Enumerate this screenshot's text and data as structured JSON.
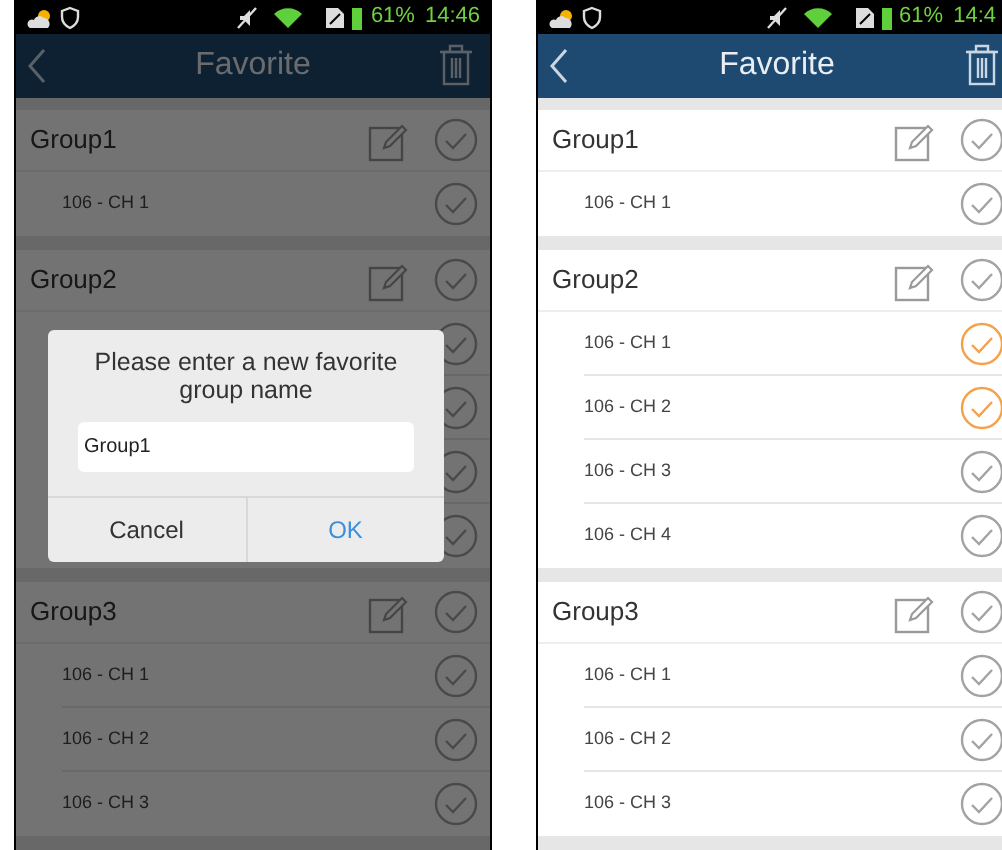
{
  "screens": [
    {
      "status_bar": {
        "battery_percent": "61%",
        "time": "14:46"
      },
      "title": "Favorite",
      "groups": [
        {
          "name": "Group1",
          "selected": false,
          "channels": [
            {
              "label": "106 - CH 1",
              "selected": false
            }
          ]
        },
        {
          "name": "Group2",
          "selected": false,
          "channels": [
            {
              "selected": false
            },
            {
              "selected": false
            },
            {
              "selected": false
            },
            {
              "selected": false
            }
          ]
        },
        {
          "name": "Group3",
          "selected": false,
          "channels": [
            {
              "label": "106 - CH 1",
              "selected": false
            },
            {
              "label": "106 - CH 2",
              "selected": false
            },
            {
              "label": "106 - CH 3",
              "selected": false
            }
          ]
        }
      ],
      "dialog": {
        "message": "Please enter a new favorite group name",
        "value": "Group1",
        "buttons": [
          {
            "label": "Cancel",
            "kind": "cancel"
          },
          {
            "label": "OK",
            "kind": "confirm"
          }
        ]
      }
    },
    {
      "status_bar": {
        "battery_percent": "61%",
        "time": "14:4"
      },
      "title": "Favorite",
      "groups": [
        {
          "name": "Group1",
          "selected": false,
          "channels": [
            {
              "label": "106 - CH 1",
              "selected": false
            }
          ]
        },
        {
          "name": "Group2",
          "selected": false,
          "channels": [
            {
              "label": "106 - CH 1",
              "selected": true
            },
            {
              "label": "106 - CH 2",
              "selected": true
            },
            {
              "label": "106 - CH 3",
              "selected": false
            },
            {
              "label": "106 - CH 4",
              "selected": false
            }
          ]
        },
        {
          "name": "Group3",
          "selected": false,
          "channels": [
            {
              "label": "106 - CH 1",
              "selected": false
            },
            {
              "label": "106 - CH 2",
              "selected": false
            },
            {
              "label": "106 - CH 3",
              "selected": false
            }
          ]
        }
      ]
    }
  ]
}
